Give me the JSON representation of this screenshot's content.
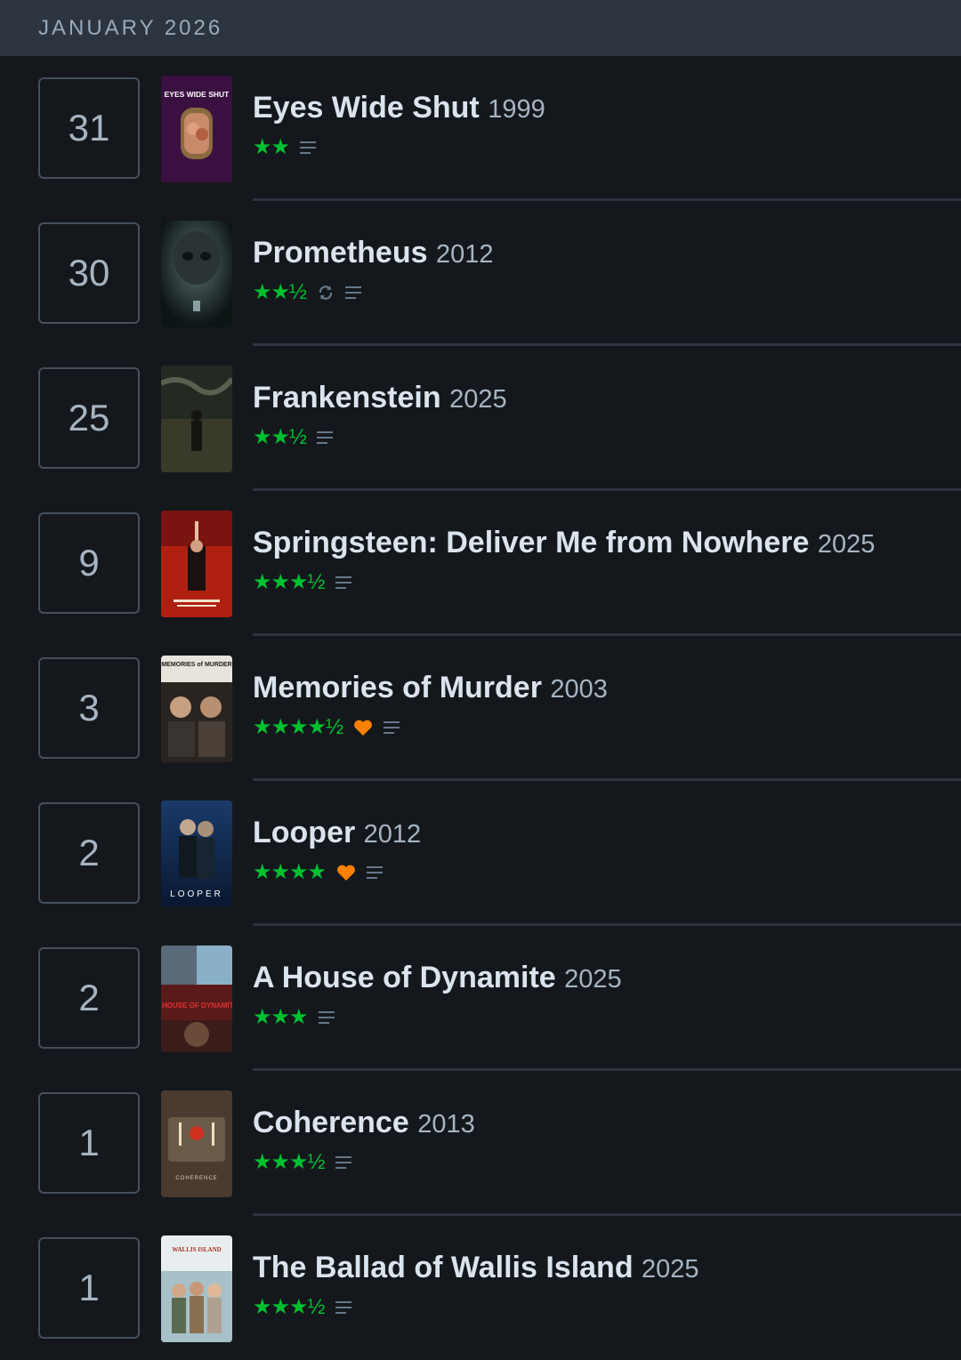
{
  "month_header": "JANUARY 2026",
  "colors": {
    "star_green": "#00c030",
    "heart_orange": "#ff8000",
    "icon_gray": "#667788"
  },
  "entries": [
    {
      "day": "31",
      "title": "Eyes Wide Shut",
      "year": "1999",
      "rating": 2,
      "stars": "★★",
      "liked": false,
      "rewatch": false,
      "review_icon": "review-lines-icon",
      "poster_text": "EYES WIDE SHUT"
    },
    {
      "day": "30",
      "title": "Prometheus",
      "year": "2012",
      "rating": 2.5,
      "stars": "★★½",
      "liked": false,
      "rewatch": true,
      "review_icon": "review-lines-icon",
      "poster_text": ""
    },
    {
      "day": "25",
      "title": "Frankenstein",
      "year": "2025",
      "rating": 2.5,
      "stars": "★★½",
      "liked": false,
      "rewatch": false,
      "review_icon": "review-lines-icon",
      "poster_text": ""
    },
    {
      "day": "9",
      "title": "Springsteen: Deliver Me from Nowhere",
      "year": "2025",
      "rating": 3.5,
      "stars": "★★★½",
      "liked": false,
      "rewatch": false,
      "review_icon": "review-lines-icon",
      "poster_text": ""
    },
    {
      "day": "3",
      "title": "Memories of Murder",
      "year": "2003",
      "rating": 4.5,
      "stars": "★★★★½",
      "liked": true,
      "rewatch": false,
      "review_icon": "review-lines-icon",
      "poster_text": "MEMORIES of MURDER"
    },
    {
      "day": "2",
      "title": "Looper",
      "year": "2012",
      "rating": 4,
      "stars": "★★★★",
      "liked": true,
      "rewatch": false,
      "review_icon": "review-lines-icon",
      "poster_text": "LOOPER"
    },
    {
      "day": "2",
      "title": "A House of Dynamite",
      "year": "2025",
      "rating": 3,
      "stars": "★★★",
      "liked": false,
      "rewatch": false,
      "review_icon": "review-lines-icon",
      "poster_text": "A HOUSE OF DYNAMITE"
    },
    {
      "day": "1",
      "title": "Coherence",
      "year": "2013",
      "rating": 3.5,
      "stars": "★★★½",
      "liked": false,
      "rewatch": false,
      "review_icon": "review-lines-icon",
      "poster_text": "COHERENCE"
    },
    {
      "day": "1",
      "title": "The Ballad of Wallis Island",
      "year": "2025",
      "rating": 3.5,
      "stars": "★★★½",
      "liked": false,
      "rewatch": false,
      "review_icon": "review-lines-icon",
      "poster_text": "WALLIS ISLAND"
    }
  ]
}
